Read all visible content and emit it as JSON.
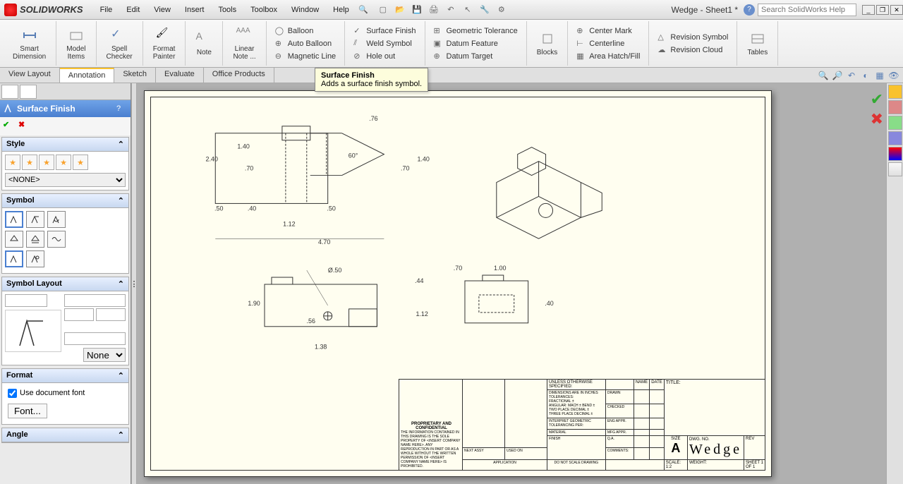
{
  "app": {
    "logo_text": "SOLIDWORKS"
  },
  "menu": {
    "file": "File",
    "edit": "Edit",
    "view": "View",
    "insert": "Insert",
    "tools": "Tools",
    "toolbox": "Toolbox",
    "window": "Window",
    "help": "Help"
  },
  "doc_title": "Wedge - Sheet1 *",
  "search": {
    "placeholder": "Search SolidWorks Help"
  },
  "ribbon": {
    "smart_dim": "Smart\nDimension",
    "model_items": "Model\nItems",
    "spell_check": "Spell\nChecker",
    "format_painter": "Format\nPainter",
    "note": "Note",
    "linear_note": "Linear\nNote ...",
    "balloon": "Balloon",
    "auto_balloon": "Auto Balloon",
    "magnetic_line": "Magnetic Line",
    "surface_finish": "Surface Finish",
    "weld_symbol": "Weld Symbol",
    "hole_callout": "Hole      out",
    "geo_tol": "Geometric Tolerance",
    "datum_feature": "Datum Feature",
    "datum_target": "Datum Target",
    "blocks": "Blocks",
    "center_mark": "Center Mark",
    "centerline": "Centerline",
    "area_hatch": "Area Hatch/Fill",
    "rev_symbol": "Revision Symbol",
    "rev_cloud": "Revision Cloud",
    "tables": "Tables"
  },
  "tooltip": {
    "title": "Surface Finish",
    "desc": "Adds a surface finish symbol."
  },
  "tabs": {
    "view_layout": "View Layout",
    "annotation": "Annotation",
    "sketch": "Sketch",
    "evaluate": "Evaluate",
    "office": "Office Products"
  },
  "pm": {
    "title": "Surface Finish",
    "style_head": "Style",
    "style_select": "<NONE>",
    "symbol_head": "Symbol",
    "layout_head": "Symbol Layout",
    "layout_select": "None",
    "format_head": "Format",
    "format_check": "Use document font",
    "font_btn": "Font...",
    "angle_head": "Angle"
  },
  "dims": {
    "d1": ".76",
    "d2": "1.40",
    "d3": "2.40",
    "d4": "1.40",
    "d5": ".70",
    "d6": ".70",
    "d7": ".50",
    "d8": ".40",
    "d9": ".50",
    "d10": "1.12",
    "d11": "4.70",
    "d12": "Ø.50",
    "d13": ".44",
    "d14": "1.90",
    "d15": ".56",
    "d16": "1.12",
    "d17": "1.38",
    "d18": ".70",
    "d19": "1.00",
    "d20": ".40",
    "angle": "60°"
  },
  "titleblock": {
    "spec": "UNLESS OTHERWISE SPECIFIED:",
    "dim_inch": "DIMENSIONS ARE IN INCHES",
    "tol": "TOLERANCES:",
    "frac": "FRACTIONAL ±",
    "ang": "ANGULAR: MACH ±   BEND ±",
    "twoplace": "TWO PLACE DECIMAL   ±",
    "threeplace": "THREE PLACE DECIMAL ±",
    "interp": "INTERPRET GEOMETRIC",
    "tolper": "TOLERANCING PER:",
    "material": "MATERIAL",
    "finish": "FINISH",
    "proprietary": "PROPRIETARY AND CONFIDENTIAL",
    "prop_text": "THE INFORMATION CONTAINED IN THIS DRAWING IS THE SOLE PROPERTY OF <INSERT COMPANY NAME HERE>. ANY REPRODUCTION IN PART OR AS A WHOLE WITHOUT THE WRITTEN PERMISSION OF <INSERT COMPANY NAME HERE> IS PROHIBITED.",
    "next_assy": "NEXT ASSY",
    "used_on": "USED ON",
    "application": "APPLICATION",
    "dns": "DO NOT SCALE DRAWING",
    "name": "NAME",
    "date": "DATE",
    "drawn": "DRAWN",
    "checked": "CHECKED",
    "eng": "ENG APPR.",
    "mfg": "MFG APPR.",
    "qa": "Q.A.",
    "comments": "COMMENTS:",
    "title_lbl": "TITLE:",
    "size": "SIZE",
    "size_a": "A",
    "dwg": "DWG.  NO.",
    "rev": "REV",
    "dwg_name": "Wedge",
    "scale": "SCALE: 1:2",
    "weight": "WEIGHT:",
    "sheet": "SHEET 1 OF 1"
  }
}
